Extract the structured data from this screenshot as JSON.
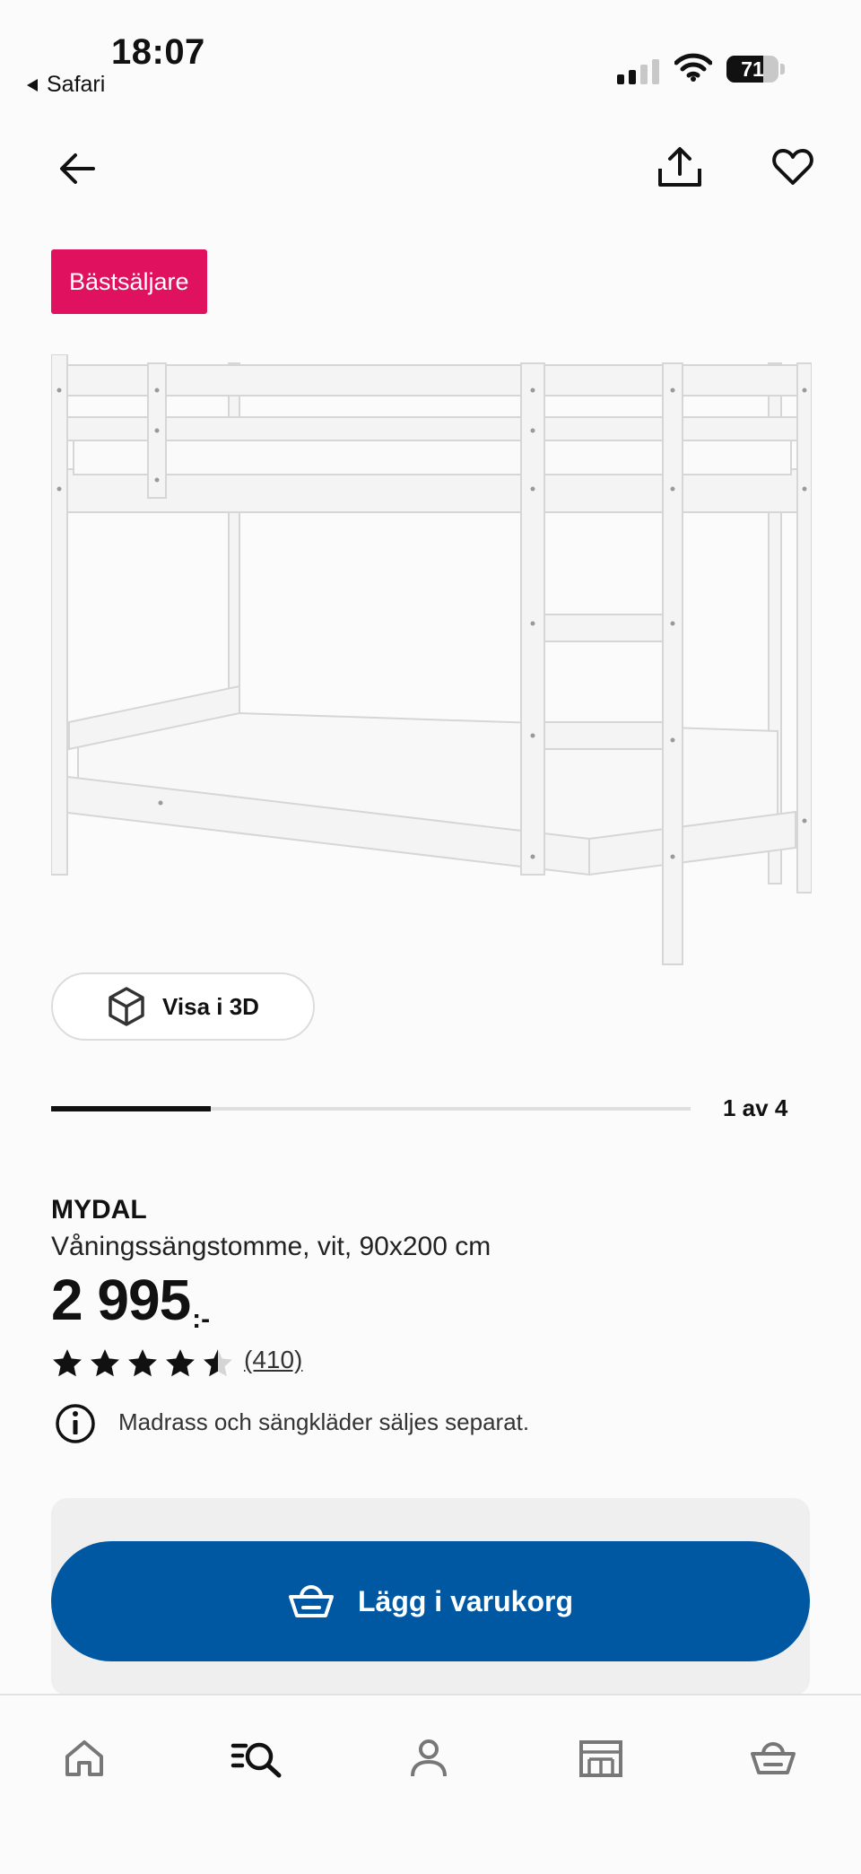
{
  "status_bar": {
    "time": "18:07",
    "back_app": "Safari",
    "battery_level": "71",
    "signal_bars_active": 2,
    "signal_bars_total": 4
  },
  "header": {
    "back_icon": "arrow-left-icon",
    "share_icon": "share-icon",
    "favorite_icon": "heart-icon"
  },
  "badge": {
    "label": "Bästsäljare",
    "color": "#e0115f"
  },
  "gallery": {
    "view_3d_label": "Visa i 3D",
    "view_3d_icon": "cube-icon",
    "pager_text": "1 av 4",
    "current_index": 1,
    "total_images": 4
  },
  "product": {
    "name": "MYDAL",
    "description": "Våningssängstomme, vit, 90x200 cm",
    "price_main": "2 995",
    "price_suffix": ":-",
    "rating": 4.5,
    "review_count": "(410)",
    "info_note": "Madrass och sängkläder säljes separat.",
    "info_icon": "info-icon"
  },
  "cart": {
    "add_label": "Lägg i varukorg",
    "cart_icon": "basket-icon",
    "button_color": "#0058a3"
  },
  "bottom_nav": {
    "items": [
      {
        "name": "home",
        "icon": "home-icon"
      },
      {
        "name": "search",
        "icon": "search-list-icon"
      },
      {
        "name": "profile",
        "icon": "person-icon"
      },
      {
        "name": "store",
        "icon": "store-icon"
      },
      {
        "name": "cart",
        "icon": "basket-icon"
      }
    ]
  }
}
